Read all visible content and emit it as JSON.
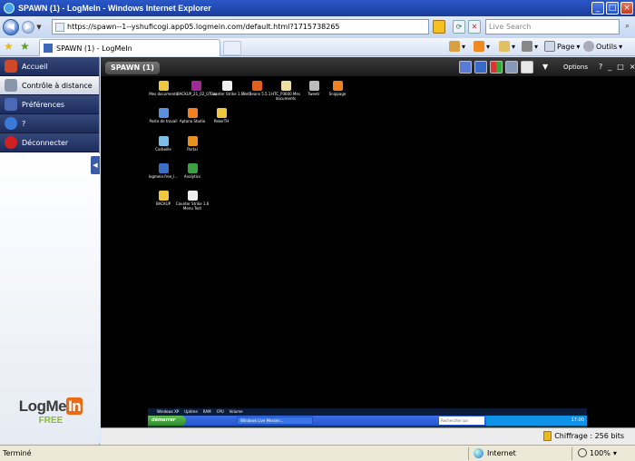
{
  "browser": {
    "title": "SPAWN (1) - LogMeIn - Windows Internet Explorer",
    "url": "https://spawn--1--yshuficogi.app05.logmein.com/default.html?1715738265",
    "search_placeholder": "Live Search",
    "tab_label": "SPAWN (1) - LogMeIn",
    "page_menu": "Page",
    "tools_menu": "Outils"
  },
  "sidebar": {
    "items": [
      {
        "label": "Accueil",
        "icon": "home-icon"
      },
      {
        "label": "Contrôle à distance",
        "icon": "remote-control-icon"
      },
      {
        "label": "Préférences",
        "icon": "preferences-icon"
      },
      {
        "label": "?",
        "icon": "help-icon"
      },
      {
        "label": "Déconnecter",
        "icon": "disconnect-icon"
      }
    ],
    "logo_main": "LogMe",
    "logo_in": "In",
    "logo_sub": "FREE"
  },
  "remote": {
    "tab": "SPAWN (1)",
    "options": "Options",
    "help": "?",
    "encryption": "Chiffrage : 256 bits"
  },
  "desktop_icons": [
    {
      "label": "Mes documents"
    },
    {
      "label": "BACKUP_21_02_07.rar"
    },
    {
      "label": "Counter Strike 1.6"
    },
    {
      "label": "NetBeans 5.5.1"
    },
    {
      "label": "HTC_P3600 Mes documents"
    },
    {
      "label": "Tweetr"
    },
    {
      "label": "Snippage"
    },
    {
      "label": "Poste de travail"
    },
    {
      "label": "Aptana Studio"
    },
    {
      "label": "PokerTH"
    },
    {
      "label": "Corbeille"
    },
    {
      "label": "Portal"
    },
    {
      "label": "logmein.free_l..."
    },
    {
      "label": "Analytics"
    },
    {
      "label": "BACKUP"
    },
    {
      "label": "Counter Strike 1.6 Menu Test"
    }
  ],
  "remote_taskbar": {
    "info": [
      "Windows XP",
      "Uptime",
      "RAM",
      "CPU",
      "Volume"
    ],
    "start": "démarrer",
    "task": "Windows Live Messen...",
    "search": "Rechercher sur l'ordinateur",
    "clock": "17:00"
  },
  "status": {
    "left": "Terminé",
    "zone": "Internet",
    "zoom": "100%"
  }
}
